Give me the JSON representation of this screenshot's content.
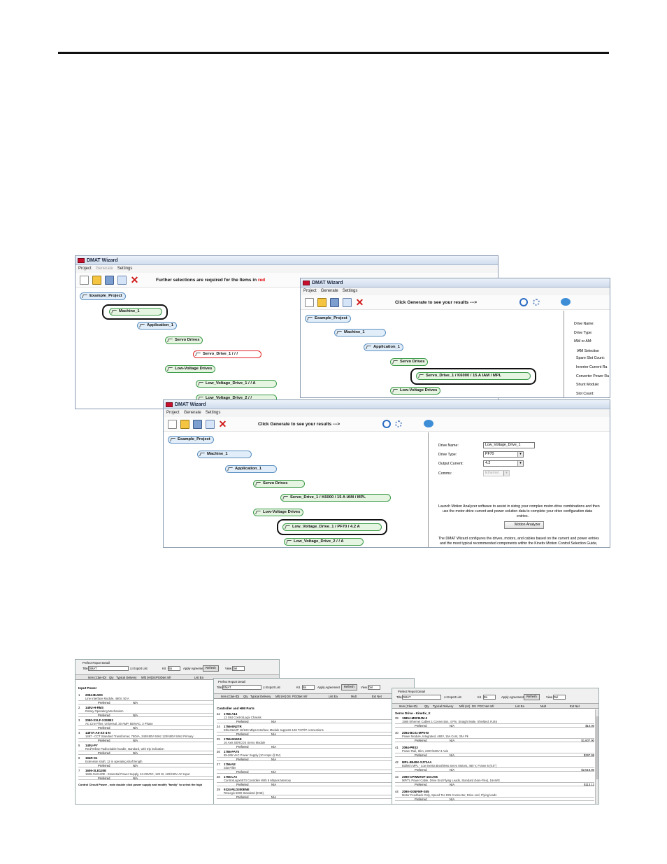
{
  "wizard": {
    "title": "DMAT Wizard",
    "menu": {
      "project": "Project",
      "generate": "Generate",
      "settings": "Settings"
    },
    "msg_prefix": "Further selections are required for the Items in",
    "msg_red": "red",
    "msg_generate": "Click Generate to see your results      --->",
    "tree": {
      "project": "Example_Project",
      "machine": "Machine_1",
      "application": "Application_1",
      "servo_drives": "Servo Drives",
      "servo_drive_empty": "Servo_Drive_1  /      /      /",
      "servo_drive_full": "Servo_Drive_1  /  K6000  /  15 A IAM  /  MPL",
      "low_voltage_drives": "Low-Voltage Drives",
      "lv1_partial": "Low_Voltage_Drive_1  /      /   A",
      "lv1_full": "Low_Voltage_Drive_1  /  PF70  /  4.2 A",
      "lv2_partial": "Low_Voltage_Drive_2  /      /   A",
      "lv2_cut": "Low_Voltage_Drive_2  /      /"
    },
    "servo_panel": {
      "drive_name": "Drive Name:",
      "drive_type": "Drive Type:",
      "iam_or_am": "IAM or AM:",
      "iam_selection": "IAM Selection",
      "spare_slot": "Spare Slot Count:",
      "inverter_current": "Inverter Current Ra",
      "converter_power": "Converter Power Ra",
      "shunt_module": "Shunt Module:",
      "slot_count": "Slot Count:"
    },
    "lv_panel": {
      "drive_name_label": "Drive Name:",
      "drive_name_value": "Low_Voltage_Drive_1",
      "drive_type_label": "Drive Type:",
      "drive_type_value": "PF70",
      "output_current_label": "Output Current:",
      "output_current_value": "4.2",
      "comms_label": "Comms:",
      "comms_value": "Ethernet",
      "launch_line1": "Launch Motion Analyzer software to assist in sizing your complex motor-drive combinations and then",
      "launch_line2": "use the motor-drive current and power solution data to complete your drive configuration data",
      "launch_line3": "entries.",
      "motion_analyzer": "Motion Analyzer",
      "dmat_line1": "The DMAT Wizard configures the drives, motors, and cables based on the current and power entries",
      "dmat_line2": "and the most typical recommended components within the Kinetix Motion Control Selection Guide,"
    }
  },
  "report": {
    "window_title": "Prefect Report Detail",
    "title_label": "Title:",
    "title_value": "DMAT",
    "title_value_2": "DMAT",
    "export_list": "Export List",
    "kit_label": "Kit",
    "kit_value": "Bo",
    "apply_agreement": "Apply Agreement",
    "refresh": "Refresh",
    "view_label": "View",
    "view_value": "Del",
    "columns": [
      "Item (Clas-ID)",
      "Qty",
      "Typical Delivery",
      "Mfd (Hr)",
      "DS",
      "PGC",
      "Net mfr",
      "List Ea",
      "Mult",
      "Ext Net"
    ],
    "sections": {
      "input_power": "Input Power",
      "controller": "Controller and HMI Parts",
      "servo": "Servo Drive - Kinetix_X",
      "control_circuit": "Control Circuit Power - note double click power supply and modify \"family\" to select the high"
    },
    "preferred": "Preferred",
    "na": "N/A",
    "left_items": [
      {
        "num": "1",
        "pn": "2094-BL50S",
        "desc": "Line Interface Module, 460V, 50 A",
        "price": "$2,630.10"
      },
      {
        "num": "2",
        "pn": "140U-H-RM3",
        "desc": "Rotary Operating Mechanism",
        "price": "$61.00"
      },
      {
        "num": "3",
        "pn": "2090-XXLF-X330B3",
        "desc": "AC Line Filter, Universal, 30 AMP, 500VAC, 3 Phase",
        "price": "$440.44"
      },
      {
        "num": "4",
        "pn": "1497A-A5-XX-4-N",
        "desc": "1497 - CCT Standard Transformer, 750VA, 240/480V 60Hz 120/480V 50Hz Primary",
        "price": "$281.10"
      },
      {
        "num": "5",
        "pn": "140U-PY",
        "desc": "Red/Yellow Padlockable handle, standard, with trip indication",
        "price": "$23.00"
      },
      {
        "num": "6",
        "pn": "194R-S1",
        "desc": "Extension shaft, 12 in operating shaft length",
        "price": "$18.00"
      },
      {
        "num": "7",
        "pn": "1606-XLE120E",
        "desc": "1606-XLE120E - Essential Power Supply, 24-28VDC, 120 W, 120/240V AC Input",
        "price": ""
      }
    ],
    "mid_items": [
      {
        "num": "22",
        "pn": "1756-A13",
        "desc": "13 Slot ControlLogix Chassis",
        "price": "$716.00"
      },
      {
        "num": "24",
        "pn": "1756-EN2TR",
        "desc": "EtherNet/IP 10/100 Mbps Interface Module supports 128 TCP/IP connections",
        "price": "$4,600.18"
      },
      {
        "num": "25",
        "pn": "1756-M16SE",
        "desc": "16 Axis SERCOS Servo Module",
        "price": "$3,600.00"
      },
      {
        "num": "26",
        "pn": "1756-PA75",
        "desc": "85-265 VAC Power Supply (10 Amps @ 5V)",
        "price": "$1,680.00"
      },
      {
        "num": "27",
        "pn": "1756-N2",
        "desc": "Slot Filler",
        "price": "$27.27"
      },
      {
        "num": "28",
        "pn": "1756-L73",
        "desc": "ControlLogix5573 Controller With 8 Mbytes Memory",
        "price": "$11,180.00"
      },
      {
        "num": "29",
        "pn": "9324-RLD300ENE",
        "desc": "RSLogix 5000 Standard (ENE)",
        "price": "$3,660.26"
      }
    ],
    "right_items": [
      {
        "num": "39",
        "pn": "1585J-M8CBJM-3",
        "desc": "1585 Ethernet Cables 1 Connection, 4 Pin, Straight Male, Shielded, RJ45",
        "price": "$10.00"
      },
      {
        "num": "40",
        "pn": "2094-BC01-MP5-M",
        "desc": "Power Module, Integrated, 460V, 15A Cont, 30A Pk",
        "price": "$1,607.90"
      },
      {
        "num": "41",
        "pn": "2094-PRS3",
        "desc": "Power Rail, Slim, 230V/460V 3 Axis",
        "price": "$297.98"
      },
      {
        "num": "42",
        "pn": "MPL-B540K-SJ72AA",
        "desc": "Bulletin MPL - Low Inertia Brushless Servo Motors, 460 V, Frame 5 (6.5\")",
        "price": "$2,516.90"
      },
      {
        "num": "43",
        "pn": "2090-CPWM7DF-16AA05",
        "desc": "MP/TL Power Cable, Drive End Flying Leads, Standard (Non-Flex), 16AWG",
        "price": "$113.12"
      },
      {
        "num": "44",
        "pn": "2090-XXNFMF-S05",
        "desc": "Motor Feedback Only, Speed Tec DIN Connector, Drive end, Flying leads",
        "price": ""
      }
    ]
  }
}
